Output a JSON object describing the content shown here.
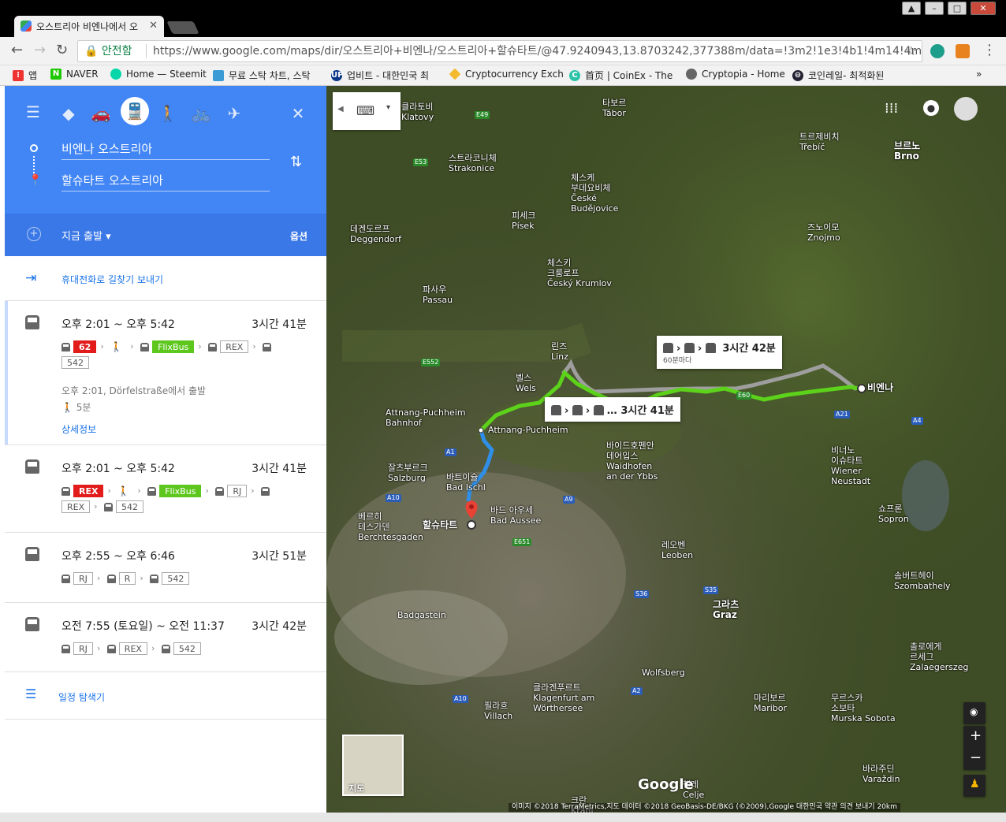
{
  "browser": {
    "tab_title": "오스트리아 비엔나에서 오",
    "secure_label": "안전함",
    "url": "https://www.google.com/maps/dir/오스트리아+비엔나/오스트리아+할슈타트/@47.9240943,13.8703242,377388m/data=!3m2!1e3!4b1!4m14!4m13!1...",
    "bookmarks": [
      "앱",
      "NAVER",
      "Home — Steemit",
      "무료 스탁 차트, 스탁",
      "업비트 - 대한민국 최",
      "Cryptocurrency Exch",
      "首页 | CoinEx - The",
      "Cryptopia - Home",
      "코인레일- 최적화된"
    ]
  },
  "directions": {
    "origin": "비엔나 오스트리아",
    "destination": "할슈타트 오스트리아",
    "depart_label": "지금 출발",
    "options_label": "옵션",
    "send_to_phone": "휴대전화로 길찾기 보내기",
    "routes": [
      {
        "time": "오후 2:01 ~ 오후 5:42",
        "duration": "3시간 41분",
        "segments": [
          "62",
          "walk",
          "FlixBus",
          "REX",
          "542"
        ],
        "note": "오후 2:01, Dörfelstraße에서 출발",
        "walk": "5분",
        "details": "상세정보"
      },
      {
        "time": "오후 2:01 ~ 오후 5:42",
        "duration": "3시간 41분",
        "segments": [
          "REX",
          "walk",
          "FlixBus",
          "RJ",
          "REX",
          "542"
        ]
      },
      {
        "time": "오후 2:55 ~ 오후 6:46",
        "duration": "3시간 51분",
        "segments": [
          "RJ",
          "R",
          "542"
        ]
      },
      {
        "time": "오전 7:55 (토요일) ~ 오전 11:37",
        "duration": "3시간 42분",
        "segments": [
          "RJ",
          "REX",
          "542"
        ]
      }
    ],
    "explore_label": "일정 탐색기"
  },
  "map": {
    "callout_main": "3시간 41분",
    "callout_alt": "3시간 42분",
    "callout_alt_sub": "60분마다",
    "start_label": "비엔나",
    "end_label": "할슈타트",
    "stop1": "Attnang-Puchheim",
    "stop2": "Attnang-Puchheim Bahnhof",
    "layer_label": "지도",
    "google": "Google",
    "attribution": "이미지 ©2018 TerraMetrics,지도 데이터 ©2018 GeoBasis-DE/BKG (©2009),Google   대한민국   약관   의견 보내기   20km"
  },
  "colors": {
    "accent": "#4285f4",
    "route_green": "#5dd21a",
    "route_blue": "#2f8fe8",
    "route_alt": "#9e9e9e"
  }
}
